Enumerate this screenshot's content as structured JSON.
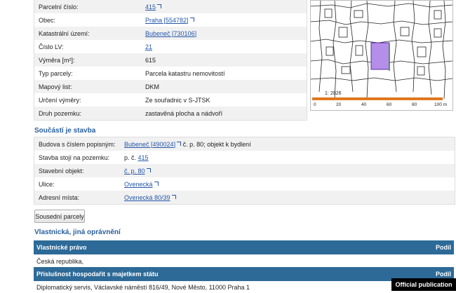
{
  "parcel": {
    "rows": [
      {
        "label": "Parcelní číslo:",
        "value": "415",
        "link": true
      },
      {
        "label": "Obec:",
        "value": "Praha [554782]",
        "link": true
      },
      {
        "label": "Katastrální území:",
        "value": "Bubeneč [730106]",
        "link": true
      },
      {
        "label": "Číslo LV:",
        "value": "21",
        "link": true
      },
      {
        "label": "Výměra [m²]:",
        "value": "615",
        "link": false
      },
      {
        "label": "Typ parcely:",
        "value": "Parcela katastru nemovitostí",
        "link": false
      },
      {
        "label": "Mapový list:",
        "value": "DKM",
        "link": false
      },
      {
        "label": "Určení výměry:",
        "value": "Ze souřadnic v S-JTSK",
        "link": false
      },
      {
        "label": "Druh pozemku:",
        "value": "zastavěná plocha a nádvoří",
        "link": false
      }
    ]
  },
  "map": {
    "scale_prefix": "1:",
    "scale_value": "2826",
    "scale_labels": [
      "0",
      "20",
      "40",
      "60",
      "80",
      "100 m"
    ],
    "parcel_color": "#b48ee8",
    "scale_color": "#e07820"
  },
  "building": {
    "title": "Součástí je stavba",
    "rows": [
      {
        "label": "Budova s číslem popisným:",
        "link_text": "Bubeneč [490024]",
        "suffix": " č. p. 80; objekt k bydlení"
      },
      {
        "label": "Stavba stojí na pozemku:",
        "prefix": "p. č. ",
        "link_text": "415",
        "suffix": ""
      },
      {
        "label": "Stavební objekt:",
        "link_text": "č. p. 80",
        "suffix": ""
      },
      {
        "label": "Ulice:",
        "link_text": "Ovenecká",
        "suffix": ""
      },
      {
        "label": "Adresní místa:",
        "link_text": "Ovenecká 80/39",
        "suffix": ""
      }
    ]
  },
  "neighbors_button": "Sousední parcely",
  "ownership": {
    "title": "Vlastnická, jiná oprávnění",
    "bar1_left": "Vlastnické právo",
    "bar1_right": "Podíl",
    "row1": "Česká republika,",
    "bar2_left": "Příslušnost hospodařit s majetkem státu",
    "bar2_right": "Podíl",
    "row2": "Diplomatický servis, Václavské náměstí 816/49, Nové Město, 11000 Praha 1"
  },
  "badge": "Official publication"
}
